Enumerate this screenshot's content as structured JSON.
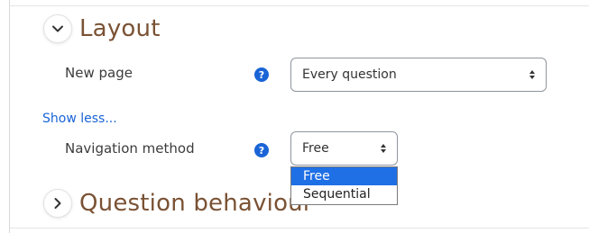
{
  "layout_section": {
    "title": "Layout",
    "toggle_icon": "chevron-down-icon"
  },
  "new_page": {
    "label": "New page",
    "help_icon": "question-circle-icon",
    "help_glyph": "?",
    "select_value": "Every question"
  },
  "show_less": "Show less...",
  "navigation_method": {
    "label": "Navigation method",
    "help_icon": "question-circle-icon",
    "help_glyph": "?",
    "select_value": "Free",
    "options": [
      "Free",
      "Sequential"
    ],
    "highlighted_option": "Free"
  },
  "question_behaviour_section": {
    "title": "Question behaviour",
    "toggle_icon": "chevron-right-icon"
  },
  "colors": {
    "section_title": "#7a5234",
    "link": "#1a64d6",
    "help_icon_bg": "#1a64d6",
    "option_highlight": "#1f6fe5"
  }
}
